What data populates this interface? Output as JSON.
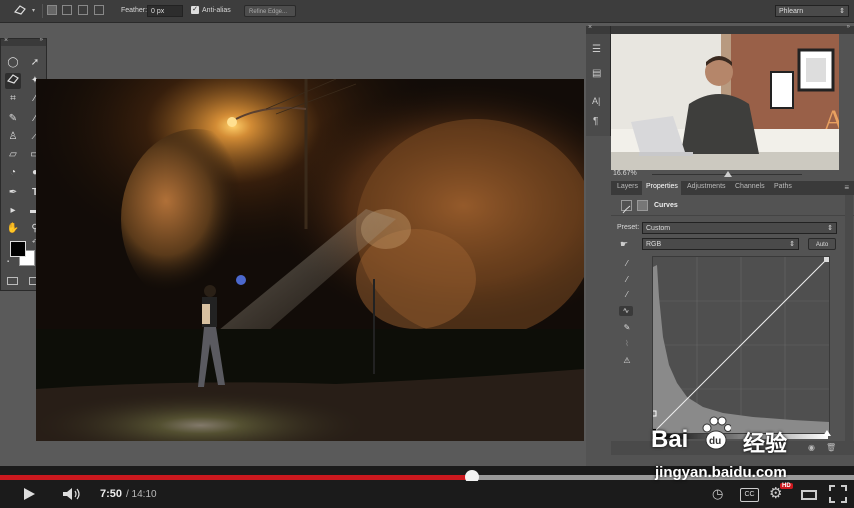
{
  "options_bar": {
    "feather_label": "Feather:",
    "feather_value": "0 px",
    "antialias_label": "Anti-alias",
    "refine_edge_label": "Refine Edge...",
    "workspace_value": "Phlearn"
  },
  "right_panel": {
    "zoom": "16.67%",
    "tabs": [
      "Layers",
      "Properties",
      "Adjustments",
      "Channels",
      "Paths"
    ],
    "active_tab": "Properties",
    "adjustment_title": "Curves",
    "preset_label": "Preset:",
    "preset_value": "Custom",
    "channel_value": "RGB",
    "auto_label": "Auto"
  },
  "player": {
    "current_time": "7:50",
    "duration": "/ 14:10",
    "played_fraction": 0.553,
    "loaded_fraction": 1.0,
    "hd_badge": "HD",
    "cc_label": "CC"
  },
  "watermark": {
    "brand_left": "Bai",
    "brand_right": "经验",
    "brand_du": "du",
    "url": "jingyan.baidu.com"
  },
  "colors": {
    "accent_red": "#cc181e",
    "ps_background": "#5a5a5a",
    "panel": "#535353"
  }
}
